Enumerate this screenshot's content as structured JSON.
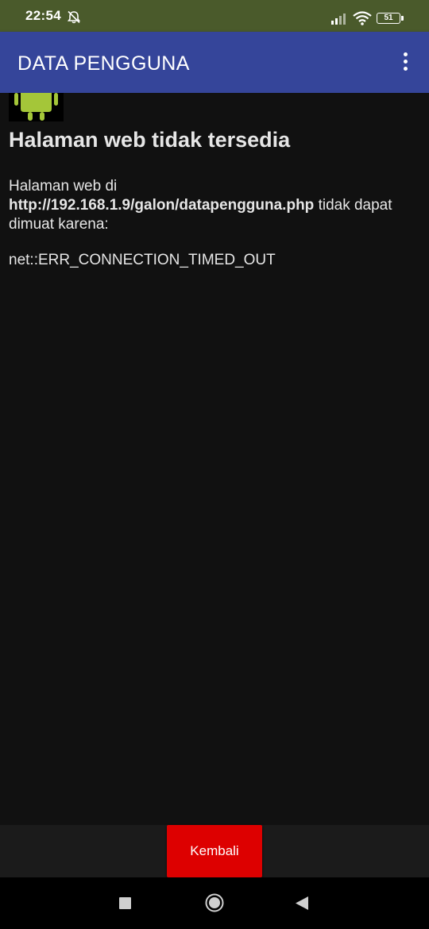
{
  "status_bar": {
    "time": "22:54",
    "battery": "51",
    "icons": [
      "silent-alarm-icon",
      "signal-icon",
      "wifi-icon",
      "battery-icon"
    ]
  },
  "app_bar": {
    "title": "DATA PENGGUNA",
    "menu_icon": "overflow-menu-icon"
  },
  "webview_error": {
    "image_icon": "android-robot-icon",
    "title": "Halaman web tidak tersedia",
    "message_prefix": "Halaman web di",
    "url": "http://192.168.1.9/galon/datapengguna.php",
    "message_suffix": "tidak dapat dimuat karena:",
    "error_code": "net::ERR_CONNECTION_TIMED_OUT"
  },
  "bottom": {
    "button_label": "Kembali"
  },
  "colors": {
    "status_bar": "#4a5a2b",
    "app_bar": "#35459a",
    "background": "#111111",
    "button": "#dd0000"
  },
  "nav_bar": {
    "icons": [
      "recent-apps-icon",
      "home-icon",
      "back-icon"
    ]
  }
}
